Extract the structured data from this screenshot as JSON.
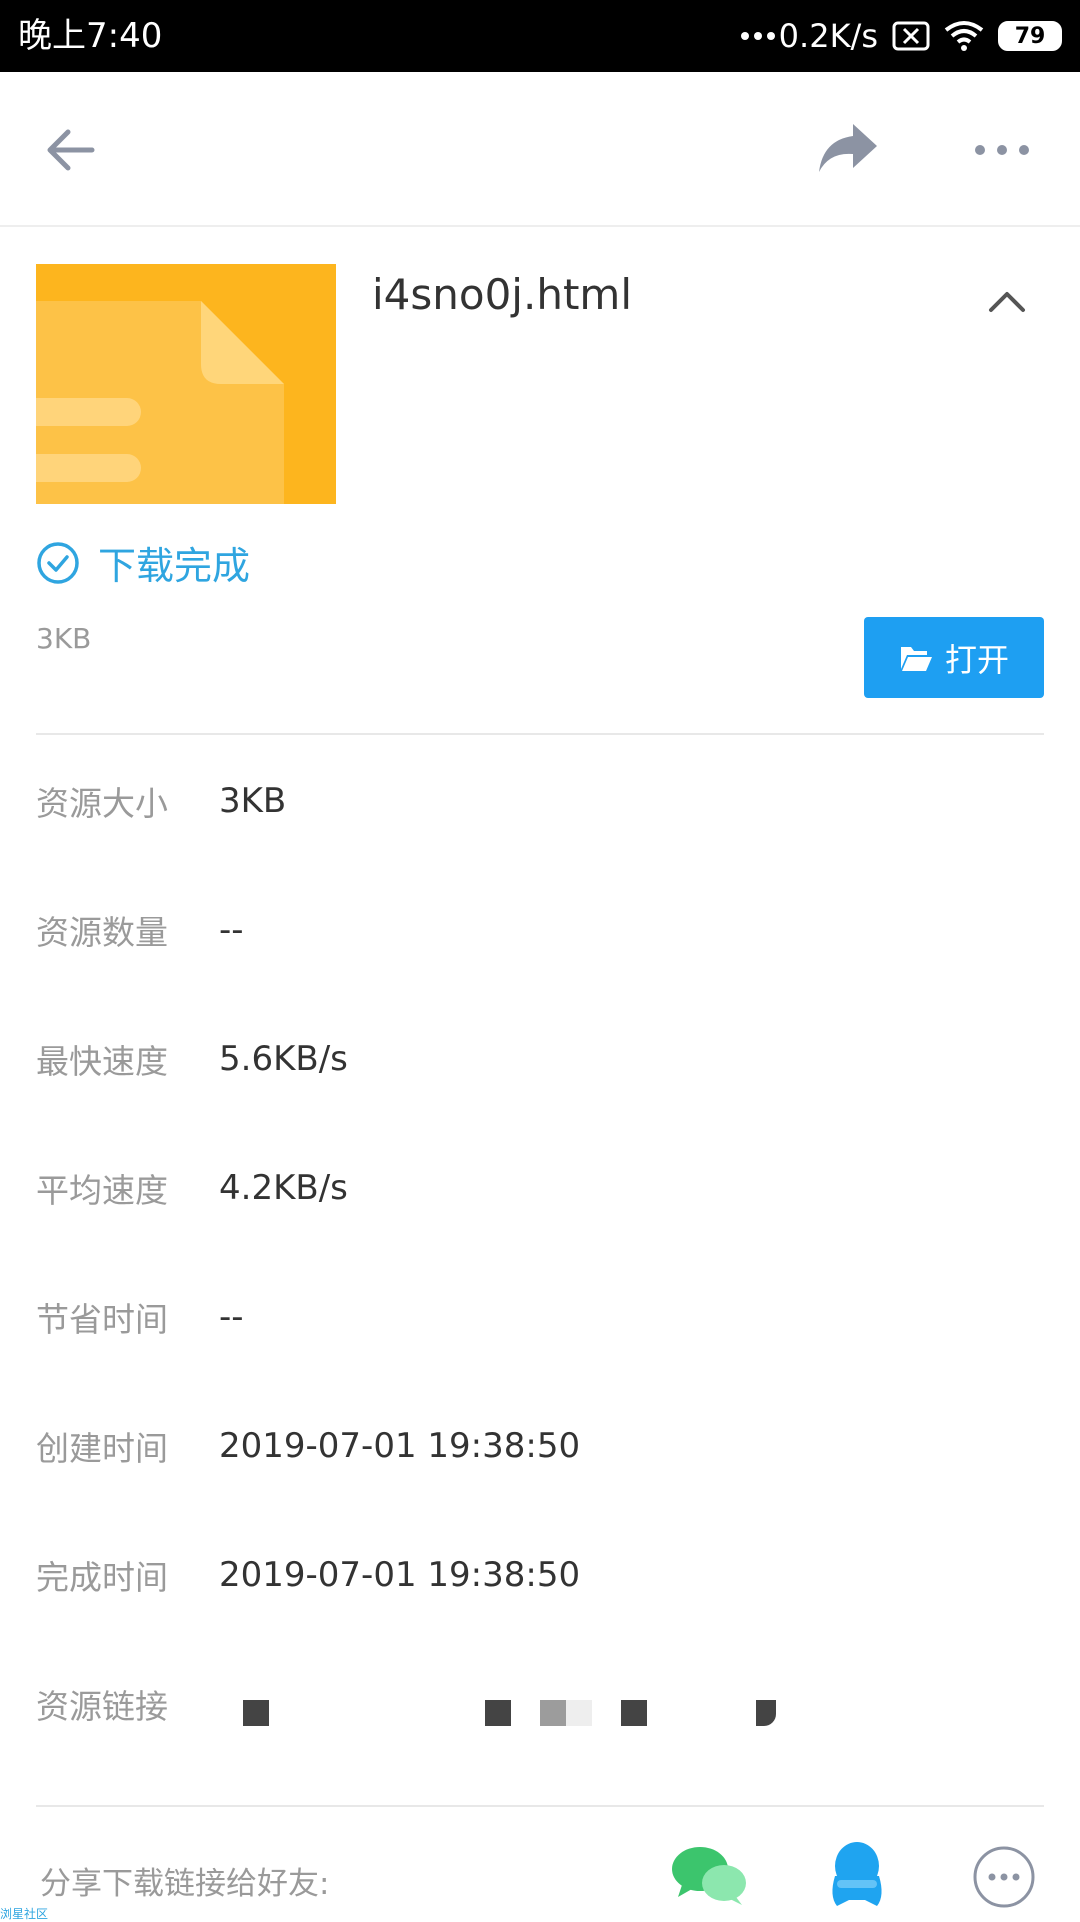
{
  "status_bar": {
    "time": "晚上7:40",
    "net_speed": "0.2K/s",
    "battery": "79"
  },
  "header": {
    "back_icon": "arrow-left-icon",
    "share_icon": "share-arrow-icon",
    "more_icon": "more-dots-icon"
  },
  "file": {
    "name": "i4sno0j.html",
    "status": "下载完成",
    "size": "3KB",
    "open_label": "打开",
    "thumb_color": "#FDB51E"
  },
  "details": [
    {
      "label": "资源大小",
      "value": "3KB"
    },
    {
      "label": "资源数量",
      "value": "--"
    },
    {
      "label": "最快速度",
      "value": "5.6KB/s"
    },
    {
      "label": "平均速度",
      "value": "4.2KB/s"
    },
    {
      "label": "节省时间",
      "value": "--"
    },
    {
      "label": "创建时间",
      "value": "2019-07-01 19:38:50"
    },
    {
      "label": "完成时间",
      "value": "2019-07-01 19:38:50"
    },
    {
      "label": "资源链接",
      "value": ""
    }
  ],
  "share": {
    "label": "分享下载链接给好友:",
    "targets": [
      "wechat-icon",
      "qq-icon",
      "more-circle-icon"
    ]
  },
  "watermark": "浏星社区",
  "colors": {
    "accent": "#1E9FF2",
    "success": "#2FA5E0",
    "label": "#9a9a9a",
    "text": "#333333"
  }
}
